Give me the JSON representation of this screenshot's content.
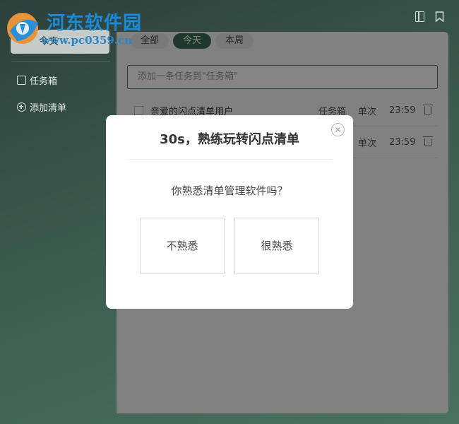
{
  "watermark": {
    "name": "河东软件园",
    "url": "www.pc0359.cn"
  },
  "sidebar": {
    "selected_label": "今天",
    "items": [
      {
        "label": "任务箱",
        "icon": "inbox-icon"
      },
      {
        "label": "添加清单",
        "icon": "add-circle-icon"
      }
    ]
  },
  "toolbar": {
    "icons": [
      "notes-icon",
      "bookmark-icon"
    ]
  },
  "tabs": [
    "全部",
    "今天",
    "本周"
  ],
  "active_tab": "今天",
  "task_input": {
    "placeholder": "添加一条任务到\"任务箱\""
  },
  "tasks": [
    {
      "title": "亲爱的闪点清单用户",
      "list": "任务箱",
      "repeat": "单次",
      "time": "23:59"
    },
    {
      "title": "",
      "list": "",
      "repeat": "单次",
      "time": "23:59"
    }
  ],
  "modal": {
    "title": "30s，熟练玩转闪点清单",
    "question": "你熟悉清单管理软件吗？",
    "options": [
      "不熟悉",
      "很熟悉"
    ]
  },
  "colors": {
    "accent": "#3f6a58",
    "sidebar_bg": "#34493f",
    "watermark": "#1c8ad6"
  }
}
